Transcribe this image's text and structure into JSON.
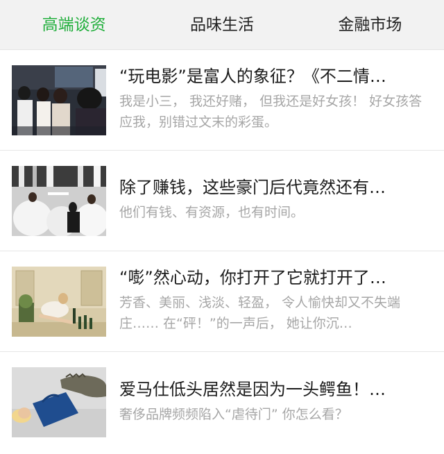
{
  "tabs": [
    {
      "label": "高端谈资",
      "active": true
    },
    {
      "label": "品味生活",
      "active": false
    },
    {
      "label": "金融市场",
      "active": false
    }
  ],
  "colors": {
    "active_tab": "#1fae3a",
    "title_text": "#1b1b1b",
    "desc_text": "#a6a6a6"
  },
  "articles": [
    {
      "title": "“玩电影”是富人的象征？《不二情…",
      "desc": "我是小三， 我还好赌， 但我还是好女孩！ 好女孩答应我，别错过文末的彩蛋。",
      "thumbnail": "film-set-photo"
    },
    {
      "title": "除了赚钱，这些豪门后代竟然还有…",
      "desc": "他们有钱、有资源，也有时间。",
      "thumbnail": "ball-gowns-photo"
    },
    {
      "title": "“嘭”然心动，你打开了它就打开了…",
      "desc": "芳香、美丽、浅淡、轻盈， 令人愉快却又不失端庄…… 在“砰！”的一声后， 她让你沉…",
      "thumbnail": "champagne-photo"
    },
    {
      "title": "爱马仕低头居然是因为一头鳄鱼！…",
      "desc": "奢侈品牌频频陷入“虐待门” 你怎么看？",
      "thumbnail": "crocodile-handbag-photo"
    }
  ]
}
